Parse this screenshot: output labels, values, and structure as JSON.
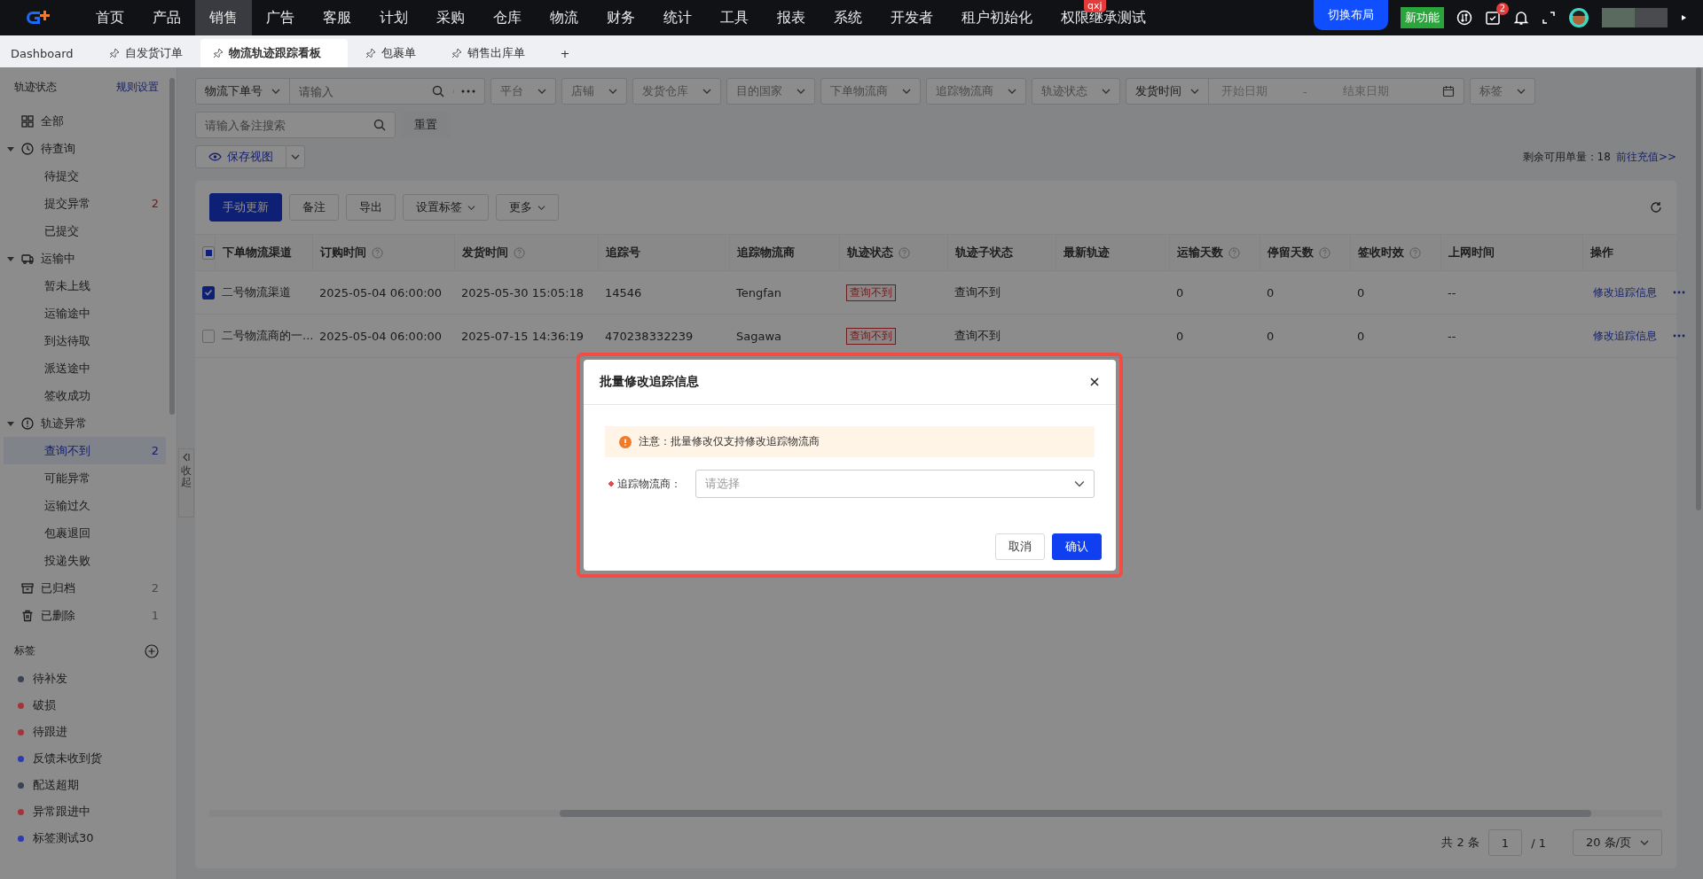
{
  "nav": {
    "items": [
      {
        "label": "首页",
        "selected": false
      },
      {
        "label": "产品",
        "selected": false
      },
      {
        "label": "销售",
        "selected": true
      },
      {
        "label": "广告",
        "selected": false
      },
      {
        "label": "客服",
        "selected": false
      },
      {
        "label": "计划",
        "selected": false
      },
      {
        "label": "采购",
        "selected": false
      },
      {
        "label": "仓库",
        "selected": false
      },
      {
        "label": "物流",
        "selected": false
      },
      {
        "label": "财务",
        "selected": false
      },
      {
        "label": "统计",
        "selected": false
      },
      {
        "label": "工具",
        "selected": false
      },
      {
        "label": "报表",
        "selected": false
      },
      {
        "label": "系统",
        "selected": false
      },
      {
        "label": "开发者",
        "selected": false
      },
      {
        "label": "租户初始化",
        "selected": false
      },
      {
        "label": "权限继承测试",
        "selected": false,
        "badge": "qxj"
      }
    ],
    "layout_button": "切换布局",
    "new_badge": "新功能",
    "todo_count": "2"
  },
  "tabs": [
    {
      "label": "Dashboard",
      "selected": false,
      "pinned": false
    },
    {
      "label": "自发货订单",
      "selected": false,
      "pinned": true
    },
    {
      "label": "物流轨迹跟踪看板",
      "selected": true,
      "pinned": true
    },
    {
      "label": "包裹单",
      "selected": false,
      "pinned": true
    },
    {
      "label": "销售出库单",
      "selected": false,
      "pinned": true
    },
    {
      "label": "+",
      "selected": false,
      "pinned": false
    }
  ],
  "sidebar": {
    "title": "轨迹状态",
    "link": "规则设置",
    "collapse": "收起",
    "tree": [
      {
        "label": "全部",
        "selected": false
      },
      {
        "label": "待查询",
        "selected": false,
        "expanded": true,
        "children": [
          {
            "label": "待提交",
            "selected": false
          },
          {
            "label": "提交异常",
            "selected": false,
            "count": "2",
            "alert": true
          },
          {
            "label": "已提交",
            "selected": false
          }
        ]
      },
      {
        "label": "运输中",
        "selected": false,
        "expanded": true,
        "children": [
          {
            "label": "暂未上线",
            "selected": false
          },
          {
            "label": "运输途中",
            "selected": false
          },
          {
            "label": "到达待取",
            "selected": false
          },
          {
            "label": "派送途中",
            "selected": false
          },
          {
            "label": "签收成功",
            "selected": false
          }
        ]
      },
      {
        "label": "轨迹异常",
        "selected": false,
        "expanded": true,
        "children": [
          {
            "label": "查询不到",
            "selected": true,
            "count": "2",
            "alert": false
          },
          {
            "label": "可能异常",
            "selected": false
          },
          {
            "label": "运输过久",
            "selected": false
          },
          {
            "label": "包裹退回",
            "selected": false
          },
          {
            "label": "投递失败",
            "selected": false
          }
        ]
      },
      {
        "label": "已归档",
        "selected": false,
        "count": "2",
        "alert": false
      },
      {
        "label": "已删除",
        "selected": false,
        "count": "1",
        "alert": false
      }
    ],
    "tags_title": "标签",
    "tags": [
      {
        "label": "待补发",
        "color": "#3a4254"
      },
      {
        "label": "破损",
        "color": "#a8323c"
      },
      {
        "label": "待跟进",
        "color": "#a8323c"
      },
      {
        "label": "反馈未收到货",
        "color": "#2a3cb0"
      },
      {
        "label": "配送超期",
        "color": "#3a4254"
      },
      {
        "label": "异常跟进中",
        "color": "#a8323c"
      },
      {
        "label": "标签测试30",
        "color": "#2a3cb0"
      }
    ]
  },
  "filters": {
    "search_type": "物流下单号",
    "search_placeholder": "请输入",
    "selects": [
      "平台",
      "店铺",
      "发货仓库",
      "目的国家",
      "下单物流商",
      "追踪物流商",
      "轨迹状态"
    ],
    "date_type": "发货时间",
    "date_start": "开始日期",
    "date_sep": "-",
    "date_end": "结束日期",
    "tag_select": "标签",
    "note_placeholder": "请输入备注搜索",
    "reset": "重置",
    "save_view": "保存视图",
    "quota_label": "剩余可用单量：",
    "quota_value": "18",
    "recharge": "前往充值>>"
  },
  "toolbar": [
    {
      "label": "手动更新",
      "kind": "primary"
    },
    {
      "label": "备注",
      "kind": "plain"
    },
    {
      "label": "导出",
      "kind": "plain"
    },
    {
      "label": "设置标签",
      "kind": "dropdown"
    },
    {
      "label": "更多",
      "kind": "dropdown"
    }
  ],
  "table": {
    "some_selected": true,
    "columns": [
      {
        "label": "下单物流渠道",
        "help": false
      },
      {
        "label": "订购时间",
        "help": true
      },
      {
        "label": "发货时间",
        "help": true
      },
      {
        "label": "追踪号",
        "help": false
      },
      {
        "label": "追踪物流商",
        "help": false
      },
      {
        "label": "轨迹状态",
        "help": true
      },
      {
        "label": "轨迹子状态",
        "help": false
      },
      {
        "label": "最新轨迹",
        "help": false
      },
      {
        "label": "运输天数",
        "help": true
      },
      {
        "label": "停留天数",
        "help": true
      },
      {
        "label": "签收时效",
        "help": true
      },
      {
        "label": "上网时间",
        "help": false
      },
      {
        "label": "操作",
        "help": false
      }
    ],
    "rows": [
      {
        "selected": true,
        "channel": "二号物流渠道",
        "order_time": "2025-05-04 06:00:00",
        "ship_time": "2025-05-30 15:05:18",
        "tracking_no": "14546",
        "carrier": "Tengfan",
        "status": "查询不到",
        "sub_status": "查询不到",
        "transit_days": "0",
        "stay_days": "0",
        "sign_days": "0",
        "online_time": "--",
        "action": "修改追踪信息"
      },
      {
        "selected": false,
        "channel": "二号物流商的一...",
        "order_time": "2025-05-04 06:00:00",
        "ship_time": "2025-07-15 14:36:19",
        "tracking_no": "470238332239",
        "carrier": "Sagawa",
        "status": "查询不到",
        "sub_status": "查询不到",
        "transit_days": "0",
        "stay_days": "0",
        "sign_days": "0",
        "online_time": "--",
        "action": "修改追踪信息"
      }
    ]
  },
  "pagination": {
    "total": "共 2 条",
    "page": "1",
    "pages": "/ 1",
    "page_size": "20 条/页"
  },
  "dialog": {
    "title": "批量修改追踪信息",
    "notice": "注意：批量修改仅支持修改追踪物流商",
    "field_label": "追踪物流商：",
    "field_placeholder": "请选择",
    "cancel": "取消",
    "confirm": "确认"
  }
}
